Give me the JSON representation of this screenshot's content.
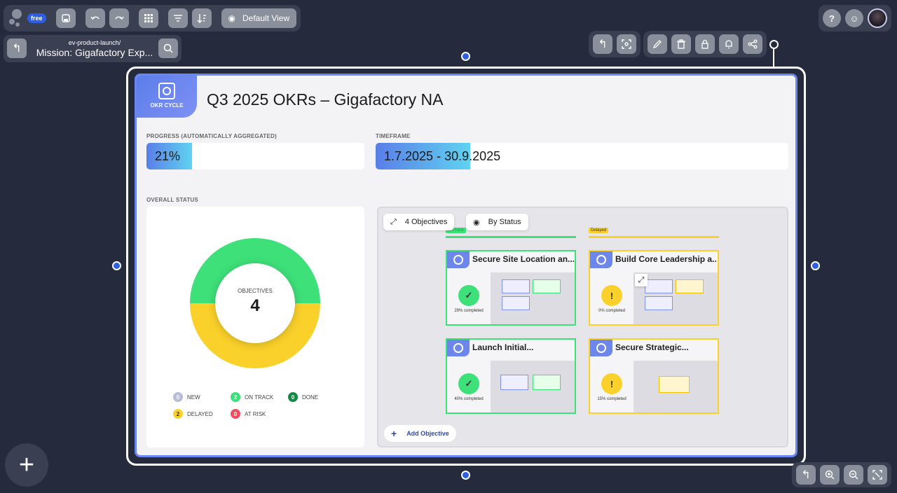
{
  "app": {
    "plan_badge": "free"
  },
  "toolbar": {
    "view_label": "Default View"
  },
  "path": {
    "parent": "ev-product-launch/",
    "current": "Mission: Gigafactory Exp..."
  },
  "card": {
    "tag_label": "OKR CYCLE",
    "title": "Q3 2025 OKRs – Gigafactory NA",
    "progress_label": "PROGRESS (AUTOMATICALLY AGGREGATED)",
    "progress_value": "21%",
    "progress_fraction": 0.21,
    "timeframe_label": "TIMEFRAME",
    "timeframe_value": "1.7.2025 - 30.9.2025",
    "timeframe_fraction": 0.23,
    "status_label": "OVERALL STATUS"
  },
  "donut": {
    "center_label": "OBJECTIVES",
    "center_value": "4",
    "segments": [
      {
        "name": "ON TRACK",
        "value": 2,
        "color": "#3ee07a"
      },
      {
        "name": "DELAYED",
        "value": 2,
        "color": "#fad12a"
      }
    ]
  },
  "legend": [
    {
      "count": "0",
      "label": "NEW",
      "color": "#b8bcd6"
    },
    {
      "count": "2",
      "label": "ON TRACK",
      "color": "#3ee07a"
    },
    {
      "count": "0",
      "label": "DONE",
      "color": "#138a43"
    },
    {
      "count": "2",
      "label": "DELAYED",
      "color": "#fad12a"
    },
    {
      "count": "0",
      "label": "AT RISK",
      "color": "#f04e5e"
    }
  ],
  "board": {
    "objectives_pill": "4 Objectives",
    "status_pill": "By Status",
    "col_ontrack": "On track",
    "col_delayed": "Delayed",
    "add_objective": "Add Objective"
  },
  "objectives": [
    {
      "title": "Secure Site Location an...",
      "progress": "29% completed",
      "status": "on-track",
      "color": "#3ee07a"
    },
    {
      "title": "Build Core Leadership a...",
      "progress": "0% completed",
      "status": "delayed",
      "color": "#fad12a"
    },
    {
      "title": "Launch Initial...",
      "progress": "40% completed",
      "status": "on-track",
      "color": "#3ee07a"
    },
    {
      "title": "Secure Strategic...",
      "progress": "15% completed",
      "status": "delayed",
      "color": "#fad12a"
    }
  ]
}
